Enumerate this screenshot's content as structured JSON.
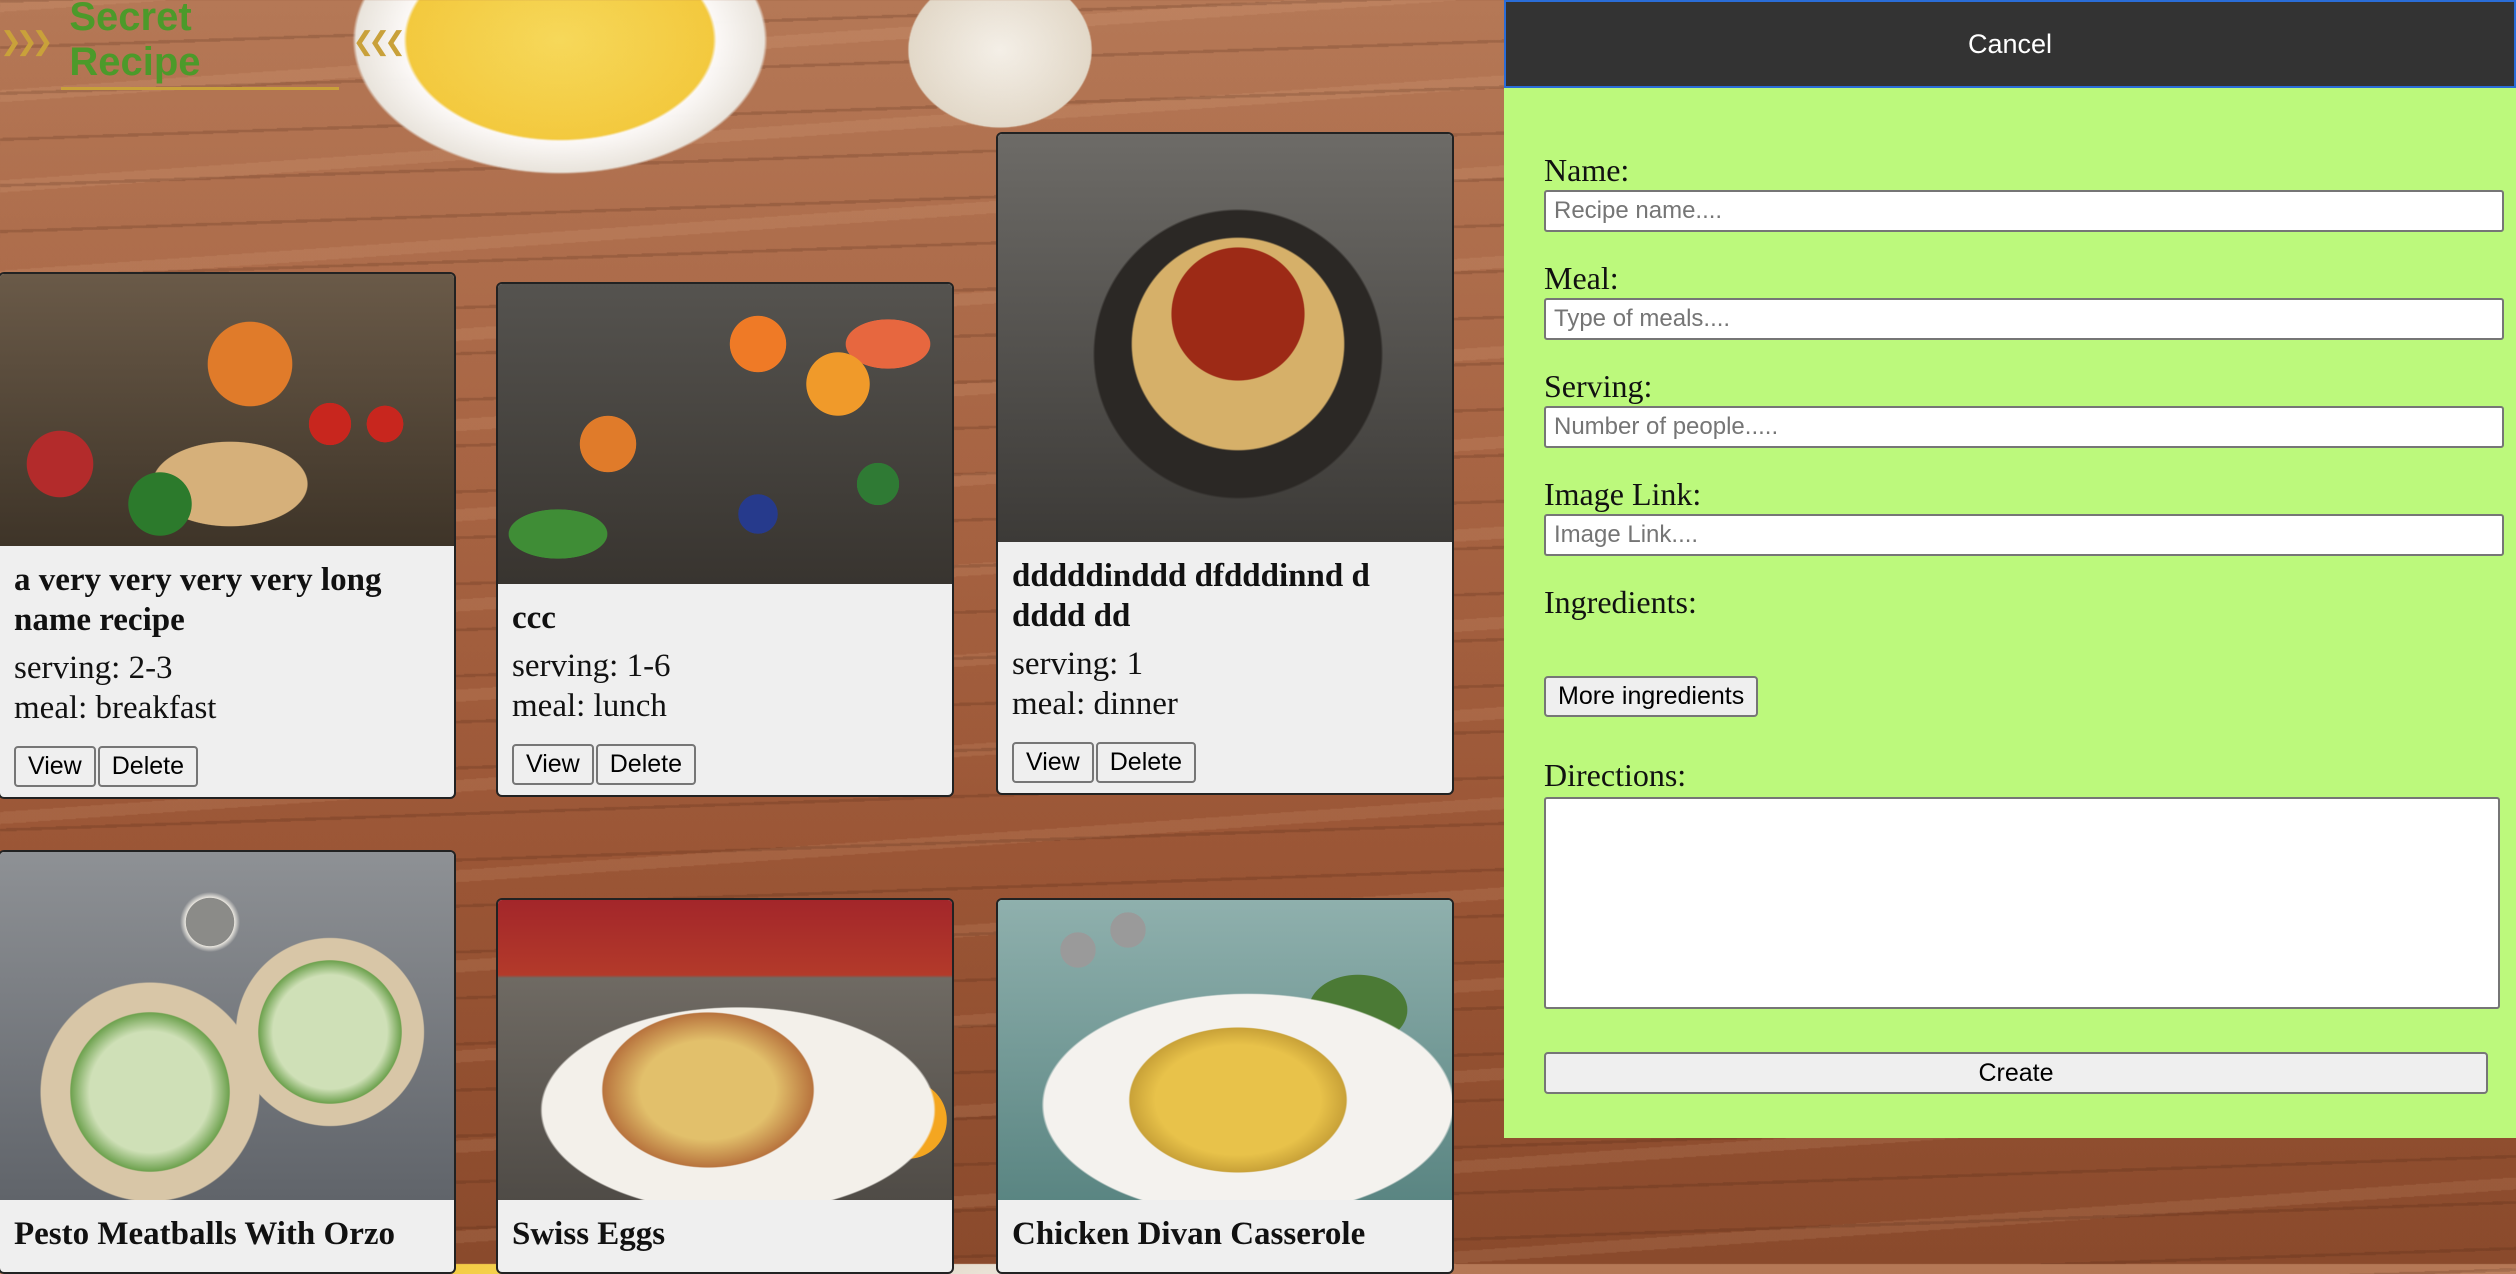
{
  "app": {
    "logo_text": "Secret Recipe"
  },
  "recipes": [
    {
      "title": "a very very very very long name recipe",
      "serving": "serving: 2-3",
      "meal": "meal: breakfast",
      "view_label": "View",
      "delete_label": "Delete"
    },
    {
      "title": "ccc",
      "serving": "serving: 1-6",
      "meal": "meal: lunch",
      "view_label": "View",
      "delete_label": "Delete"
    },
    {
      "title": "dddddinddd dfdddinnd d dddd dd",
      "serving": "serving: 1",
      "meal": "meal: dinner",
      "view_label": "View",
      "delete_label": "Delete"
    },
    {
      "title": "Pesto Meatballs With Orzo"
    },
    {
      "title": "Swiss Eggs"
    },
    {
      "title": "Chicken Divan Casserole"
    }
  ],
  "form": {
    "cancel_label": "Cancel",
    "name_label": "Name:",
    "name_placeholder": "Recipe name....",
    "meal_label": "Meal:",
    "meal_placeholder": "Type of meals....",
    "serving_label": "Serving:",
    "serving_placeholder": "Number of people.....",
    "image_label": "Image Link:",
    "image_placeholder": "Image Link....",
    "ingredients_label": "Ingredients:",
    "more_ingredients_label": "More ingredients",
    "directions_label": "Directions:",
    "create_label": "Create"
  }
}
